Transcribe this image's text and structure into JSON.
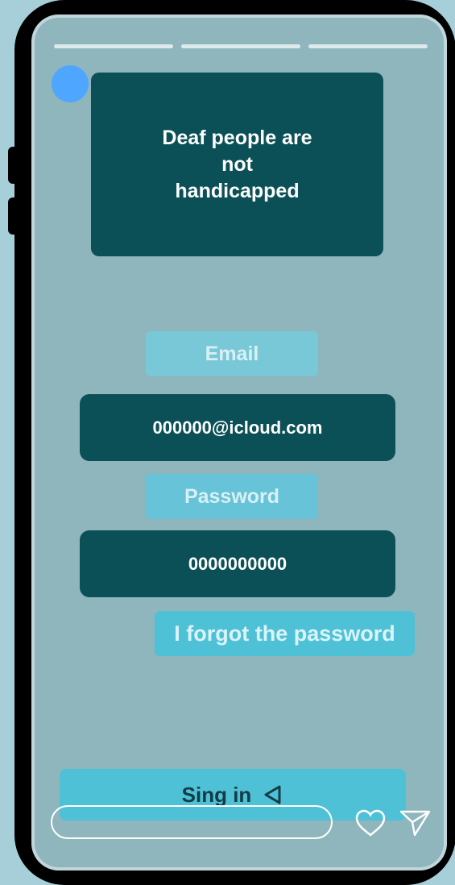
{
  "headline": {
    "text": "Deaf people are\nnot\nhandicapped"
  },
  "login": {
    "email_label": "Email",
    "email_value": "000000@icloud.com",
    "password_label": "Password",
    "password_value": "0000000000",
    "forgot_label": "I forgot the password",
    "signin_label": "Sing in"
  },
  "icons": {
    "avatar": "profile-avatar",
    "signin_arrow": "back-arrow-icon",
    "heart": "heart-icon",
    "send": "send-icon"
  },
  "colors": {
    "background": "#a7cfda",
    "screen": "#8fb5bd",
    "dark_card": "#0b5056",
    "accent": "#4fc1d6"
  }
}
